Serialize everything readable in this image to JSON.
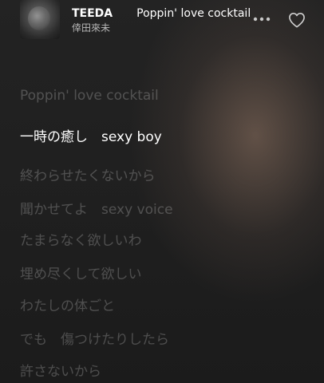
{
  "header": {
    "artist_short": "TEEDA",
    "song_title": "Poppin' love cocktail",
    "artist": "倖田來未"
  },
  "icons": {
    "more": "more-icon",
    "heart": "heart-icon"
  },
  "lyrics": [
    {
      "text": "Poppin' love cocktail",
      "active": false
    },
    {
      "text": "一時の癒し　sexy boy",
      "active": true
    },
    {
      "text": "終わらせたくないから",
      "active": false
    },
    {
      "text": "聞かせてよ　sexy voice",
      "active": false
    },
    {
      "text": "たまらなく欲しいわ",
      "active": false
    },
    {
      "text": "埋め尽くして欲しい",
      "active": false
    },
    {
      "text": "わたしの体ごと",
      "active": false
    },
    {
      "text": "でも　傷つけたりしたら",
      "active": false
    },
    {
      "text": "許さないから",
      "active": false
    }
  ],
  "colors": {
    "active_lyric": "#ffffff",
    "inactive_lyric": "rgba(255,255,255,0.22)",
    "background": "#1e1e1e"
  }
}
